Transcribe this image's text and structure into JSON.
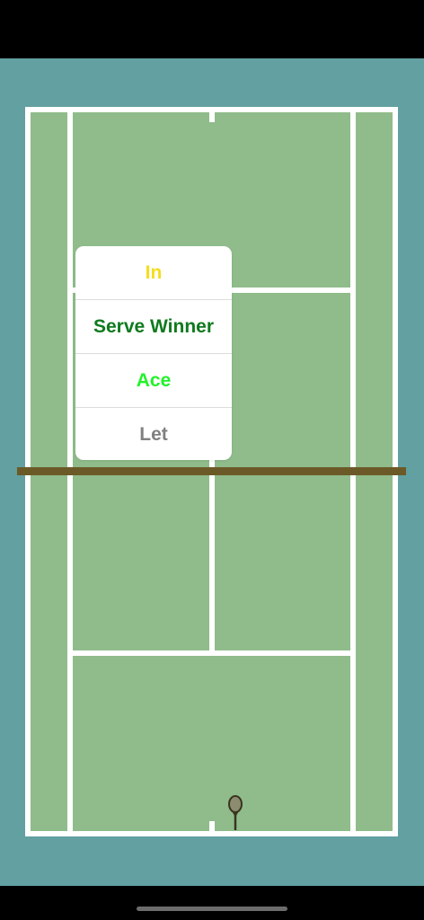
{
  "colors": {
    "surround": "#62a0a2",
    "court": "#8fbc8a",
    "lines": "#ffffff",
    "net": "#6b5a28",
    "racket_frame": "#3a3320",
    "racket_head": "#8b8c70"
  },
  "popup_menu": {
    "items": [
      {
        "label": "In",
        "color": "#f5dd1e"
      },
      {
        "label": "Serve Winner",
        "color": "#0f7a1e"
      },
      {
        "label": "Ace",
        "color": "#22f22a"
      },
      {
        "label": "Let",
        "color": "#808080"
      }
    ]
  },
  "icons": {
    "racket": "tennis-racket-icon"
  }
}
